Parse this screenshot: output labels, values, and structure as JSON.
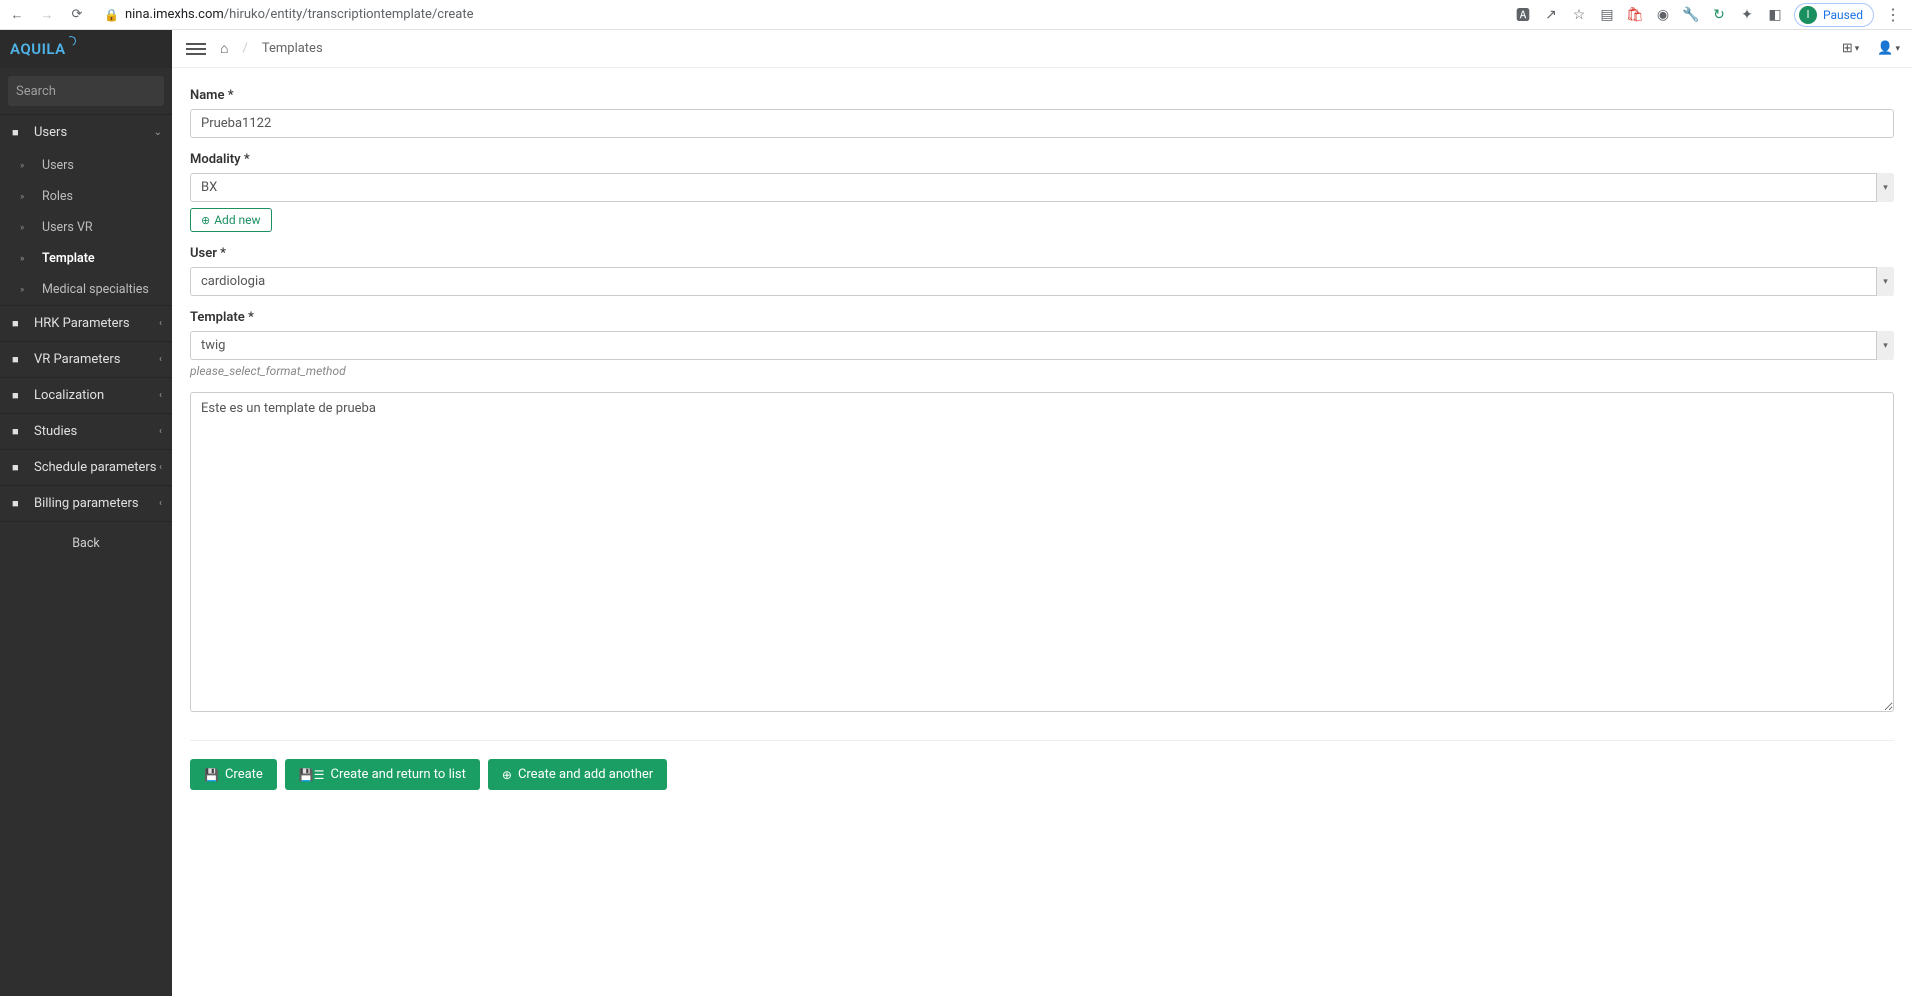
{
  "browser": {
    "url_host": "nina.imexhs.com",
    "url_path": "/hiruko/entity/transcriptiontemplate/create",
    "profile_status": "Paused",
    "profile_initial": "I"
  },
  "logo": "AQUILA",
  "search": {
    "placeholder": "Search"
  },
  "sidebar": {
    "groups": [
      {
        "label": "Users",
        "expanded": true,
        "items": [
          {
            "label": "Users"
          },
          {
            "label": "Roles"
          },
          {
            "label": "Users VR"
          },
          {
            "label": "Template",
            "active": true
          },
          {
            "label": "Medical specialties"
          }
        ]
      },
      {
        "label": "HRK Parameters"
      },
      {
        "label": "VR Parameters"
      },
      {
        "label": "Localization"
      },
      {
        "label": "Studies"
      },
      {
        "label": "Schedule parameters"
      },
      {
        "label": "Billing parameters"
      }
    ],
    "back": "Back"
  },
  "breadcrumb": {
    "current": "Templates"
  },
  "form": {
    "name_label": "Name *",
    "name_value": "Prueba1122",
    "modality_label": "Modality *",
    "modality_value": "BX",
    "add_new": "Add new",
    "user_label": "User *",
    "user_value": "cardiologia",
    "template_label": "Template *",
    "template_value": "twig",
    "template_helper": "please_select_format_method",
    "body_value": "Este es un template de prueba"
  },
  "actions": {
    "create": "Create",
    "create_return": "Create and return to list",
    "create_add": "Create and add another"
  }
}
